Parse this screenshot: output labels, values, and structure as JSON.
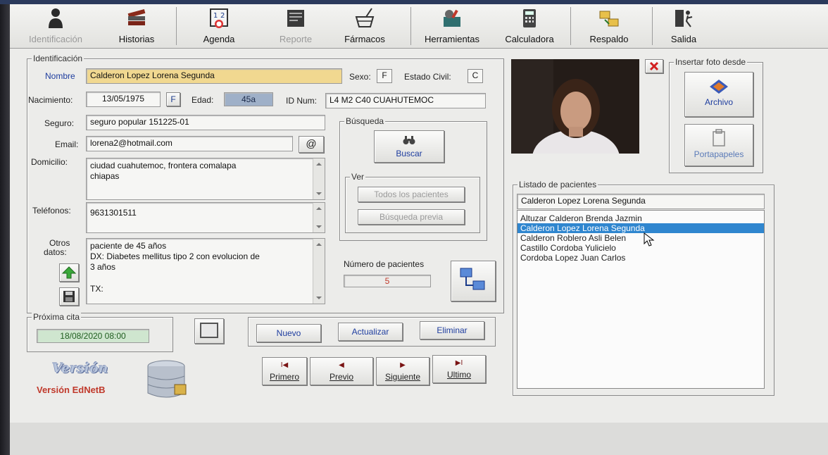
{
  "toolbar": {
    "identificacion": "Identificación",
    "historias": "Historias",
    "agenda": "Agenda",
    "reporte": "Reporte",
    "farmacos": "Fármacos",
    "herramientas": "Herramientas",
    "calculadora": "Calculadora",
    "respaldo": "Respaldo",
    "salida": "Salida"
  },
  "identificacion": {
    "group_title": "Identificación",
    "nombre_label": "Nombre",
    "nombre": "Calderon Lopez Lorena Segunda",
    "sexo_label": "Sexo:",
    "sexo": "F",
    "estado_civil_label": "Estado Civil:",
    "estado_civil": "C",
    "nacimiento_label": "Nacimiento:",
    "nacimiento": "13/05/1975",
    "nacimiento_btn": "F",
    "edad_label": "Edad:",
    "edad": "45a",
    "idnum_label": "ID Num:",
    "idnum": "L4 M2 C40 CUAHUTEMOC",
    "seguro_label": "Seguro:",
    "seguro": "seguro popular 151225-01",
    "email_label": "Email:",
    "email": "lorena2@hotmail.com",
    "email_btn": "@",
    "domicilio_label": "Domicilio:",
    "domicilio_line1": "ciudad cuahutemoc, frontera comalapa",
    "domicilio_line2": "chiapas",
    "telefonos_label": "Teléfonos:",
    "telefonos": "9631301511",
    "otros_label_1": "Otros",
    "otros_label_2": "datos:",
    "otros_line1": "paciente de 45 años",
    "otros_line2": "DX: Diabetes mellitus tipo 2 con evolucion de",
    "otros_line3": "3 años",
    "otros_line4": "TX:"
  },
  "busqueda": {
    "title": "Búsqueda",
    "buscar": "Buscar",
    "ver_title": "Ver",
    "todos": "Todos los pacientes",
    "previa": "Búsqueda previa",
    "numero_label": "Número de pacientes",
    "numero": "5"
  },
  "proxima": {
    "title": "Próxima cita",
    "value": "18/08/2020 08:00"
  },
  "actions": {
    "nuevo": "Nuevo",
    "actualizar": "Actualizar",
    "eliminar": "Eliminar"
  },
  "nav": {
    "primero": "Primero",
    "previo": "Previo",
    "siguiente": "Siguiente",
    "ultimo": "Ultimo",
    "primero_arrow": "I◀",
    "previo_arrow": "◀",
    "siguiente_arrow": "▶",
    "ultimo_arrow": "▶I"
  },
  "version": {
    "logo": "Versión",
    "text": "Versión EdNetB"
  },
  "foto": {
    "title": "Insertar foto desde",
    "archivo": "Archivo",
    "portapapeles": "Portapapeles"
  },
  "listado": {
    "title": "Listado de pacientes",
    "search": "Calderon Lopez Lorena Segunda",
    "items": [
      "Altuzar Calderon Brenda Jazmin",
      "Calderon Lopez Lorena Segunda",
      "Calderon Roblero Asli Belen",
      "Castillo Cordoba Yulicielo",
      "Cordoba Lopez Juan Carlos"
    ]
  }
}
